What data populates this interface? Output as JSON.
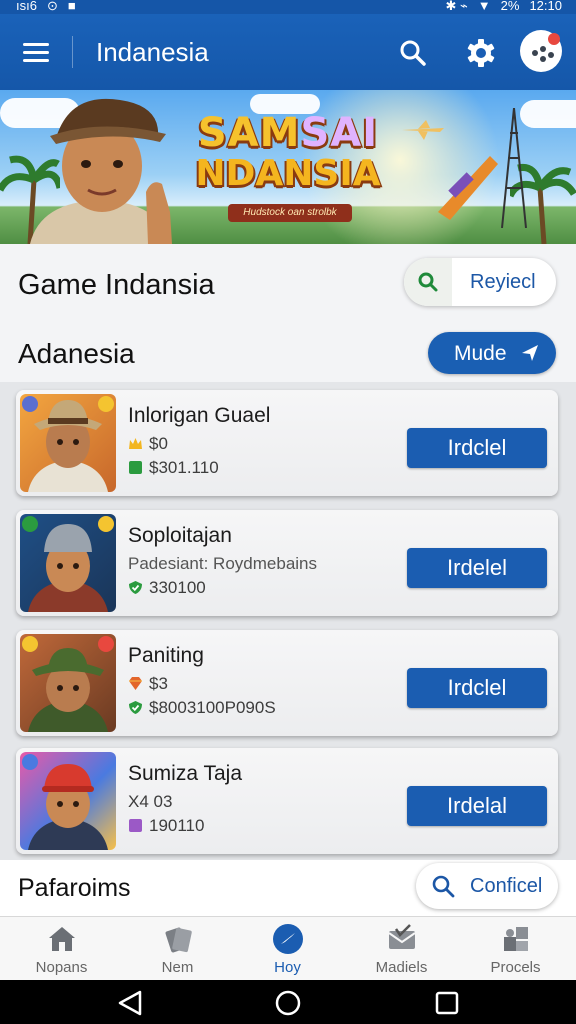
{
  "status_bar": {
    "time_left": "ısı6",
    "battery": "2%",
    "time": "12:10"
  },
  "app_bar": {
    "title": "Indanesia"
  },
  "banner": {
    "title_line1_a": "SAM",
    "title_line1_b": "SAI",
    "title_line2": "NDANSIA",
    "ribbon": "Hudstock oan strolbk"
  },
  "header": {
    "title": "Game Indansia",
    "search_pill_label": "Reyiecl"
  },
  "section": {
    "title": "Adanesia",
    "filter_button_label": "Mude"
  },
  "games": [
    {
      "name": "Inlorigan Guael",
      "meta1": "$0",
      "meta2": "$301.110",
      "meta1_icon": "crown-icon",
      "meta2_icon": "green-square-icon",
      "action_label": "Irdclel"
    },
    {
      "name": "Soploitajan",
      "meta1": "Padesiant: Roydmebains",
      "meta2": "330100",
      "meta1_icon": "",
      "meta2_icon": "green-check-icon",
      "action_label": "Irdelel"
    },
    {
      "name": "Paniting",
      "meta1": "$3",
      "meta2": "$8003100P090S",
      "meta1_icon": "gem-icon",
      "meta2_icon": "green-check-icon",
      "action_label": "Irdclel"
    },
    {
      "name": "Sumiza Taja",
      "meta1": "X4 03",
      "meta2": "190110",
      "meta1_icon": "",
      "meta2_icon": "purple-square-icon",
      "action_label": "Irdelal"
    }
  ],
  "footer_row": {
    "title": "Pafaroims",
    "button_label": "Conficel"
  },
  "bottom_nav": [
    {
      "label": "Nopans",
      "icon": "home-icon"
    },
    {
      "label": "Nem",
      "icon": "cards-icon"
    },
    {
      "label": "Hoy",
      "icon": "compass-icon"
    },
    {
      "label": "Madiels",
      "icon": "inbox-icon"
    },
    {
      "label": "Procels",
      "icon": "puzzle-icon"
    }
  ],
  "colors": {
    "primary": "#1a5fb3",
    "accent_green": "#2b9b3f"
  }
}
